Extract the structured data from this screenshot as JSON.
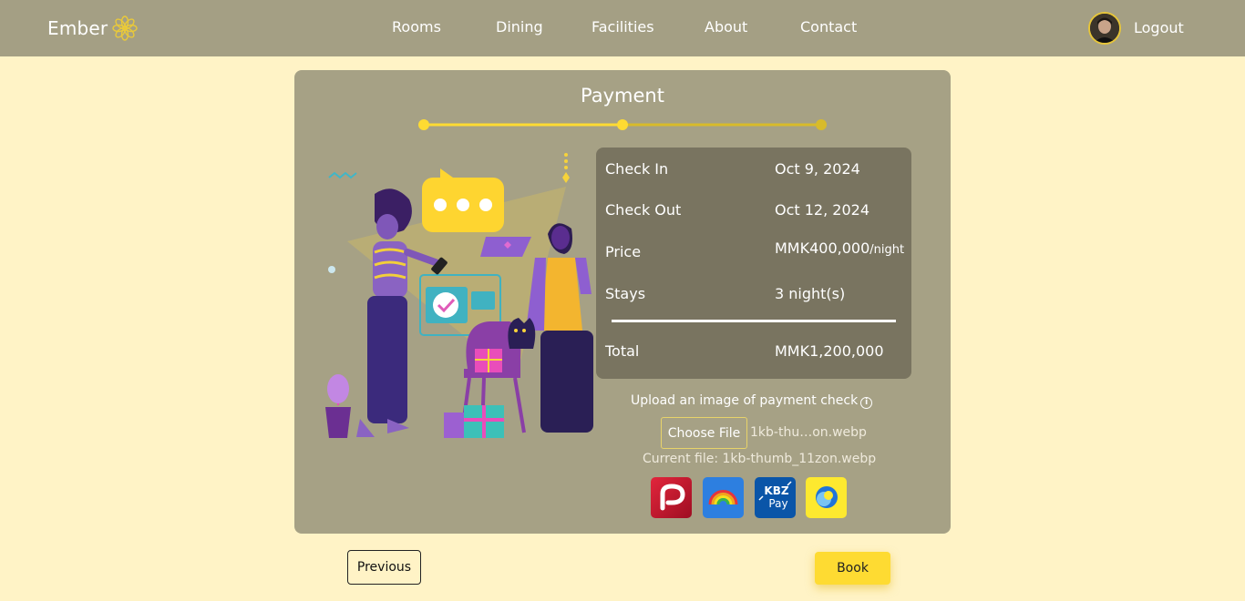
{
  "nav": {
    "brand": "Ember",
    "links": [
      "Rooms",
      "Dining",
      "Facilities",
      "About",
      "Contact"
    ],
    "logout": "Logout"
  },
  "page": {
    "title": "Payment",
    "step_current": 2,
    "step_total": 3
  },
  "summary": {
    "rows": [
      {
        "label": "Check In",
        "value": "Oct 9, 2024"
      },
      {
        "label": "Check Out",
        "value": "Oct 12, 2024"
      },
      {
        "label": "Price",
        "value": "MMK400,000",
        "unit": "/night"
      },
      {
        "label": "Stays",
        "value": "3 night(s)"
      }
    ],
    "total_label": "Total",
    "total_value": "MMK1,200,000"
  },
  "upload": {
    "label": "Upload an image of payment check",
    "button": "Choose File",
    "selected_file": "1kb-thu…on.webp",
    "current_file": "Current file: 1kb-thumb_11zon.webp"
  },
  "payment_methods": [
    "ayapay-icon",
    "uab-pay-icon",
    "kbzpay-icon",
    "wave-pay-icon"
  ],
  "kbz_text": {
    "line1": "KBZ",
    "line2": "Pay"
  },
  "actions": {
    "previous": "Previous",
    "book": "Book"
  },
  "colors": {
    "background": "#fff3c6",
    "navbar": "#a49f84",
    "card": "#a6a185",
    "summary": "#797460",
    "accent": "#fedb32"
  }
}
